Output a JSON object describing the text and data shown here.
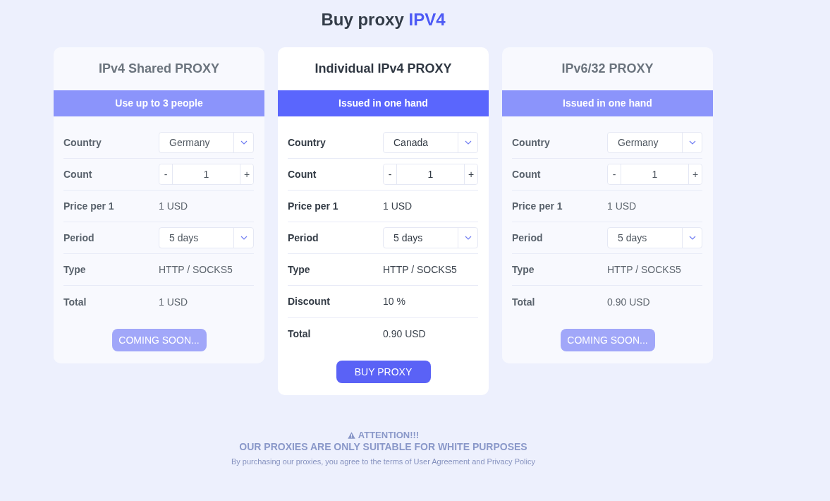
{
  "page_title": {
    "text": "Buy proxy",
    "accent": "IPV4"
  },
  "cards": [
    {
      "title": "IPv4 Shared PROXY",
      "banner": "Use up to 3 people",
      "disabled": true,
      "rows": [
        {
          "kind": "select",
          "label": "Country",
          "value": "Germany"
        },
        {
          "kind": "stepper",
          "label": "Count",
          "value": "1",
          "decrement": "-",
          "increment": "+"
        },
        {
          "kind": "text",
          "label": "Price per 1",
          "value": "1 USD"
        },
        {
          "kind": "select",
          "label": "Period",
          "value": "5 days"
        },
        {
          "kind": "text",
          "label": "Type",
          "value": "HTTP / SOCKS5"
        },
        {
          "kind": "text",
          "label": "Total",
          "value": "1 USD"
        }
      ],
      "button": "COMING SOON..."
    },
    {
      "title": "Individual IPv4 PROXY",
      "banner": "Issued in one hand",
      "disabled": false,
      "rows": [
        {
          "kind": "select",
          "label": "Country",
          "value": "Canada"
        },
        {
          "kind": "stepper",
          "label": "Count",
          "value": "1",
          "decrement": "-",
          "increment": "+"
        },
        {
          "kind": "text",
          "label": "Price per 1",
          "value": "1 USD"
        },
        {
          "kind": "select",
          "label": "Period",
          "value": "5 days"
        },
        {
          "kind": "text",
          "label": "Type",
          "value": "HTTP / SOCKS5"
        },
        {
          "kind": "text",
          "label": "Discount",
          "value": "10 %"
        },
        {
          "kind": "text",
          "label": "Total",
          "value": "0.90 USD"
        }
      ],
      "button": "BUY PROXY"
    },
    {
      "title": "IPv6/32 PROXY",
      "banner": "Issued in one hand",
      "disabled": true,
      "rows": [
        {
          "kind": "select",
          "label": "Country",
          "value": "Germany"
        },
        {
          "kind": "stepper",
          "label": "Count",
          "value": "1",
          "decrement": "-",
          "increment": "+"
        },
        {
          "kind": "text",
          "label": "Price per 1",
          "value": "1 USD"
        },
        {
          "kind": "select",
          "label": "Period",
          "value": "5 days"
        },
        {
          "kind": "text",
          "label": "Type",
          "value": "HTTP / SOCKS5"
        },
        {
          "kind": "text",
          "label": "Total",
          "value": "0.90 USD"
        }
      ],
      "button": "COMING SOON..."
    }
  ],
  "notice": {
    "heading": "ATTENTION!!!",
    "warning": "OUR PROXIES ARE ONLY SUITABLE FOR WHITE PURPOSES",
    "terms": "By purchasing our proxies, you agree to the terms of User Agreement and Privacy Policy"
  }
}
